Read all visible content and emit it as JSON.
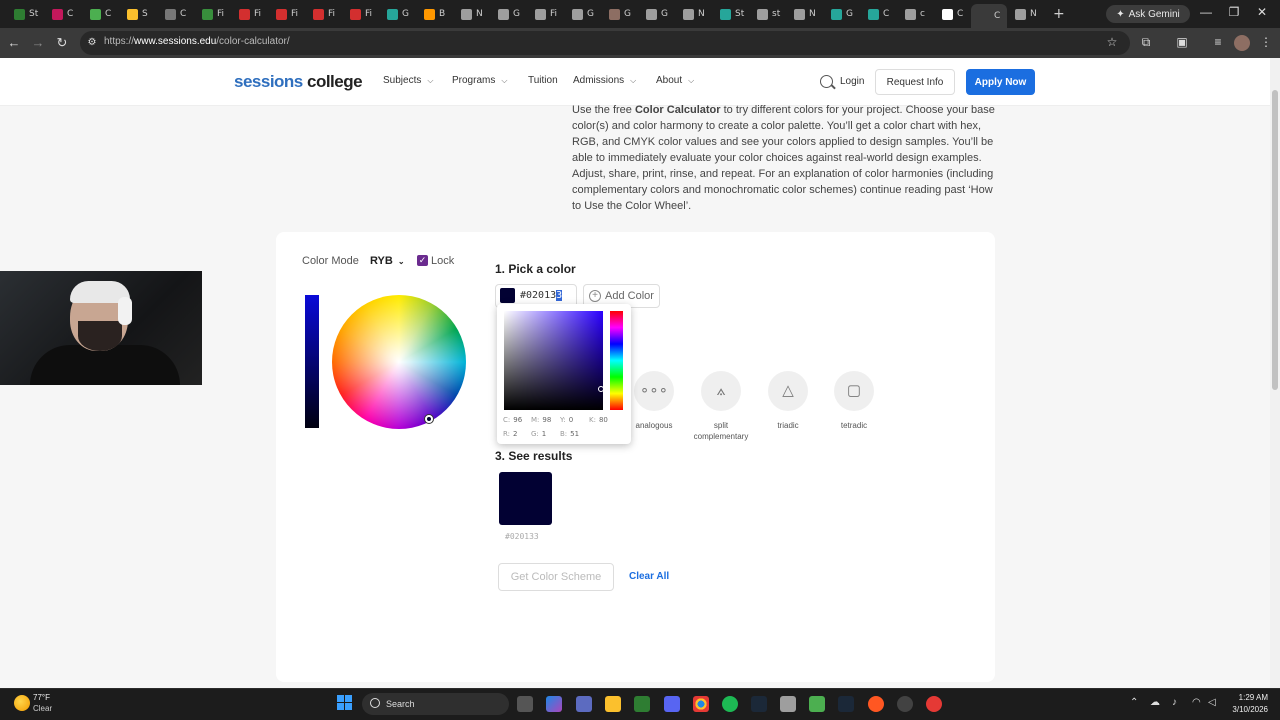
{
  "browser": {
    "tabs": [
      {
        "label": "St",
        "color": "#2e7d32"
      },
      {
        "label": "C",
        "color": "#c2185b"
      },
      {
        "label": "C",
        "color": "#4caf50"
      },
      {
        "label": "S",
        "color": "#fbc02d"
      },
      {
        "label": "C",
        "color": "#777777"
      },
      {
        "label": "Fi",
        "color": "#388e3c"
      },
      {
        "label": "Fi",
        "color": "#d32f2f"
      },
      {
        "label": "Fi",
        "color": "#d32f2f"
      },
      {
        "label": "Fi",
        "color": "#d32f2f"
      },
      {
        "label": "Fi",
        "color": "#d32f2f"
      },
      {
        "label": "G",
        "color": "#26a69a"
      },
      {
        "label": "B",
        "color": "#ff9800"
      },
      {
        "label": "N",
        "color": "#9e9e9e"
      },
      {
        "label": "G",
        "color": "#9e9e9e"
      },
      {
        "label": "Fi",
        "color": "#9e9e9e"
      },
      {
        "label": "G",
        "color": "#9e9e9e"
      },
      {
        "label": "G",
        "color": "#8d6e63"
      },
      {
        "label": "G",
        "color": "#9e9e9e"
      },
      {
        "label": "N",
        "color": "#9e9e9e"
      },
      {
        "label": "St",
        "color": "#26a69a"
      },
      {
        "label": "st",
        "color": "#9e9e9e"
      },
      {
        "label": "N",
        "color": "#9e9e9e"
      },
      {
        "label": "G",
        "color": "#26a69a"
      },
      {
        "label": "C",
        "color": "#26a69a"
      },
      {
        "label": "c",
        "color": "#9e9e9e"
      },
      {
        "label": "C",
        "color": "#ffffff"
      },
      {
        "label": "C",
        "color": "#3a3a3a"
      },
      {
        "label": "N",
        "color": "#9e9e9e"
      }
    ],
    "ask_gemini": "Ask Gemini",
    "url_prefix": "https://",
    "url_host": "www.sessions.edu",
    "url_path": "/color-calculator/"
  },
  "site": {
    "logo_part1": "sessions",
    "logo_part2": " college",
    "nav": [
      {
        "label": "Subjects",
        "chevron": true
      },
      {
        "label": "Programs",
        "chevron": true
      },
      {
        "label": "Tuition",
        "chevron": false
      },
      {
        "label": "Admissions",
        "chevron": true
      },
      {
        "label": "About",
        "chevron": true
      }
    ],
    "login": "Login",
    "request_info": "Request Info",
    "apply_now": "Apply Now"
  },
  "intro": {
    "before": "Use the free ",
    "bold": "Color Calculator",
    "after": " to try different colors for your project. Choose your base color(s) and color harmony to create a color palette. You’ll get a color chart with hex, RGB, and CMYK color values and see your colors applied to design samples. You’ll be able to immediately evaluate your color choices against real-world design examples. Adjust, share, print, rinse, and repeat. For an explanation of color harmonies (including complementary colors and monochromatic color schemes) continue reading past ‘How to Use the Color Wheel’."
  },
  "calculator": {
    "mode_label": "Color Mode",
    "mode_value": "RYB",
    "lock_checked": true,
    "lock_label": "Lock",
    "step1": "1. Pick a color",
    "hex_main": "#02013",
    "hex_selected": "3",
    "add_color": "Add Color",
    "selected_color": "#020133",
    "picker": {
      "c_label": "C:",
      "c": "96",
      "m_label": "M:",
      "m": "98",
      "y_label": "Y:",
      "y": "0",
      "k_label": "K:",
      "k": "80",
      "r_label": "R:",
      "r": "2",
      "g_label": "G:",
      "g": "1",
      "b_label": "B:",
      "b": "51"
    },
    "harmonies": [
      {
        "label": "analogous",
        "icon": "analogous-icon",
        "glyph": "∘∘∘"
      },
      {
        "label": "split complementary",
        "icon": "split-complementary-icon",
        "glyph": "⟑"
      },
      {
        "label": "triadic",
        "icon": "triadic-icon",
        "glyph": "△"
      },
      {
        "label": "tetradic",
        "icon": "tetradic-icon",
        "glyph": "▢"
      }
    ],
    "step3": "3. See results",
    "result_hex": "#020133",
    "get_scheme": "Get Color Scheme",
    "clear_all": "Clear All"
  },
  "taskbar": {
    "temp": "77°F",
    "weather": "Clear",
    "search": "Search",
    "time": "1:29 AM",
    "date": "3/10/2026"
  }
}
